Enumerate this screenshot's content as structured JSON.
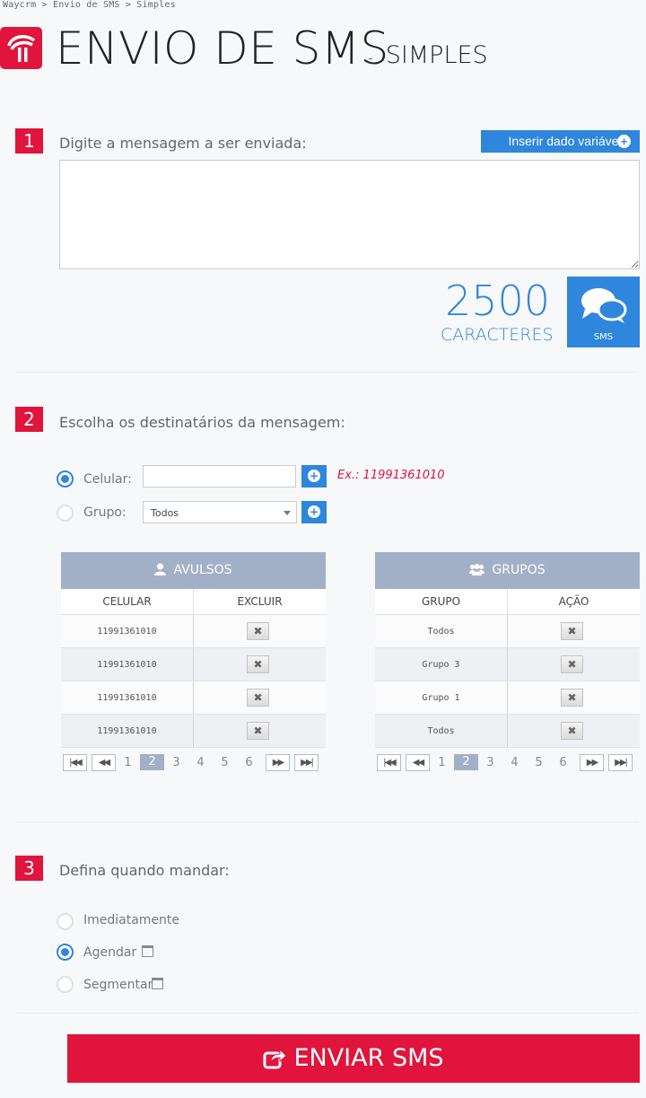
{
  "breadcrumb": "Waycrm > Envio de SMS > Simples",
  "header": {
    "title": "ENVIO DE SMS",
    "dash": "-",
    "subtitle": "SIMPLES"
  },
  "step1": {
    "number": "1",
    "label": "Digite a mensagem a ser enviada:",
    "insert_button": "Inserir dado variável",
    "message_value": "",
    "counter_value": "2500",
    "counter_label": "CARACTERES",
    "sms_badge": "SMS"
  },
  "step2": {
    "number": "2",
    "label": "Escolha os destinatários da mensagem:",
    "celular_label": "Celular:",
    "celular_value": "",
    "example": "Ex.: 11991361010",
    "grupo_label": "Grupo:",
    "grupo_selected": "Todos",
    "selected_option": "celular",
    "avulsos": {
      "title": "AVULSOS",
      "col1": "CELULAR",
      "col2": "EXCLUIR",
      "rows": [
        "11991361010",
        "11991361010",
        "11991361010",
        "11991361010"
      ]
    },
    "grupos": {
      "title": "GRUPOS",
      "col1": "GRUPO",
      "col2": "AÇÃO",
      "rows": [
        "Todos",
        "Grupo 3",
        "Grupo 1",
        "Todos"
      ]
    },
    "pager": {
      "pages": [
        "1",
        "2",
        "3",
        "4",
        "5",
        "6"
      ],
      "current": "2"
    }
  },
  "step3": {
    "number": "3",
    "label": "Defina quando mandar:",
    "options": [
      "Imediatamente",
      "Agendar",
      "Segmentar"
    ],
    "selected": "Agendar"
  },
  "send_button": "ENVIAR SMS",
  "colors": {
    "accent_red": "#e0143c",
    "accent_blue": "#2f86dd",
    "table_header": "#a2b0c7"
  }
}
